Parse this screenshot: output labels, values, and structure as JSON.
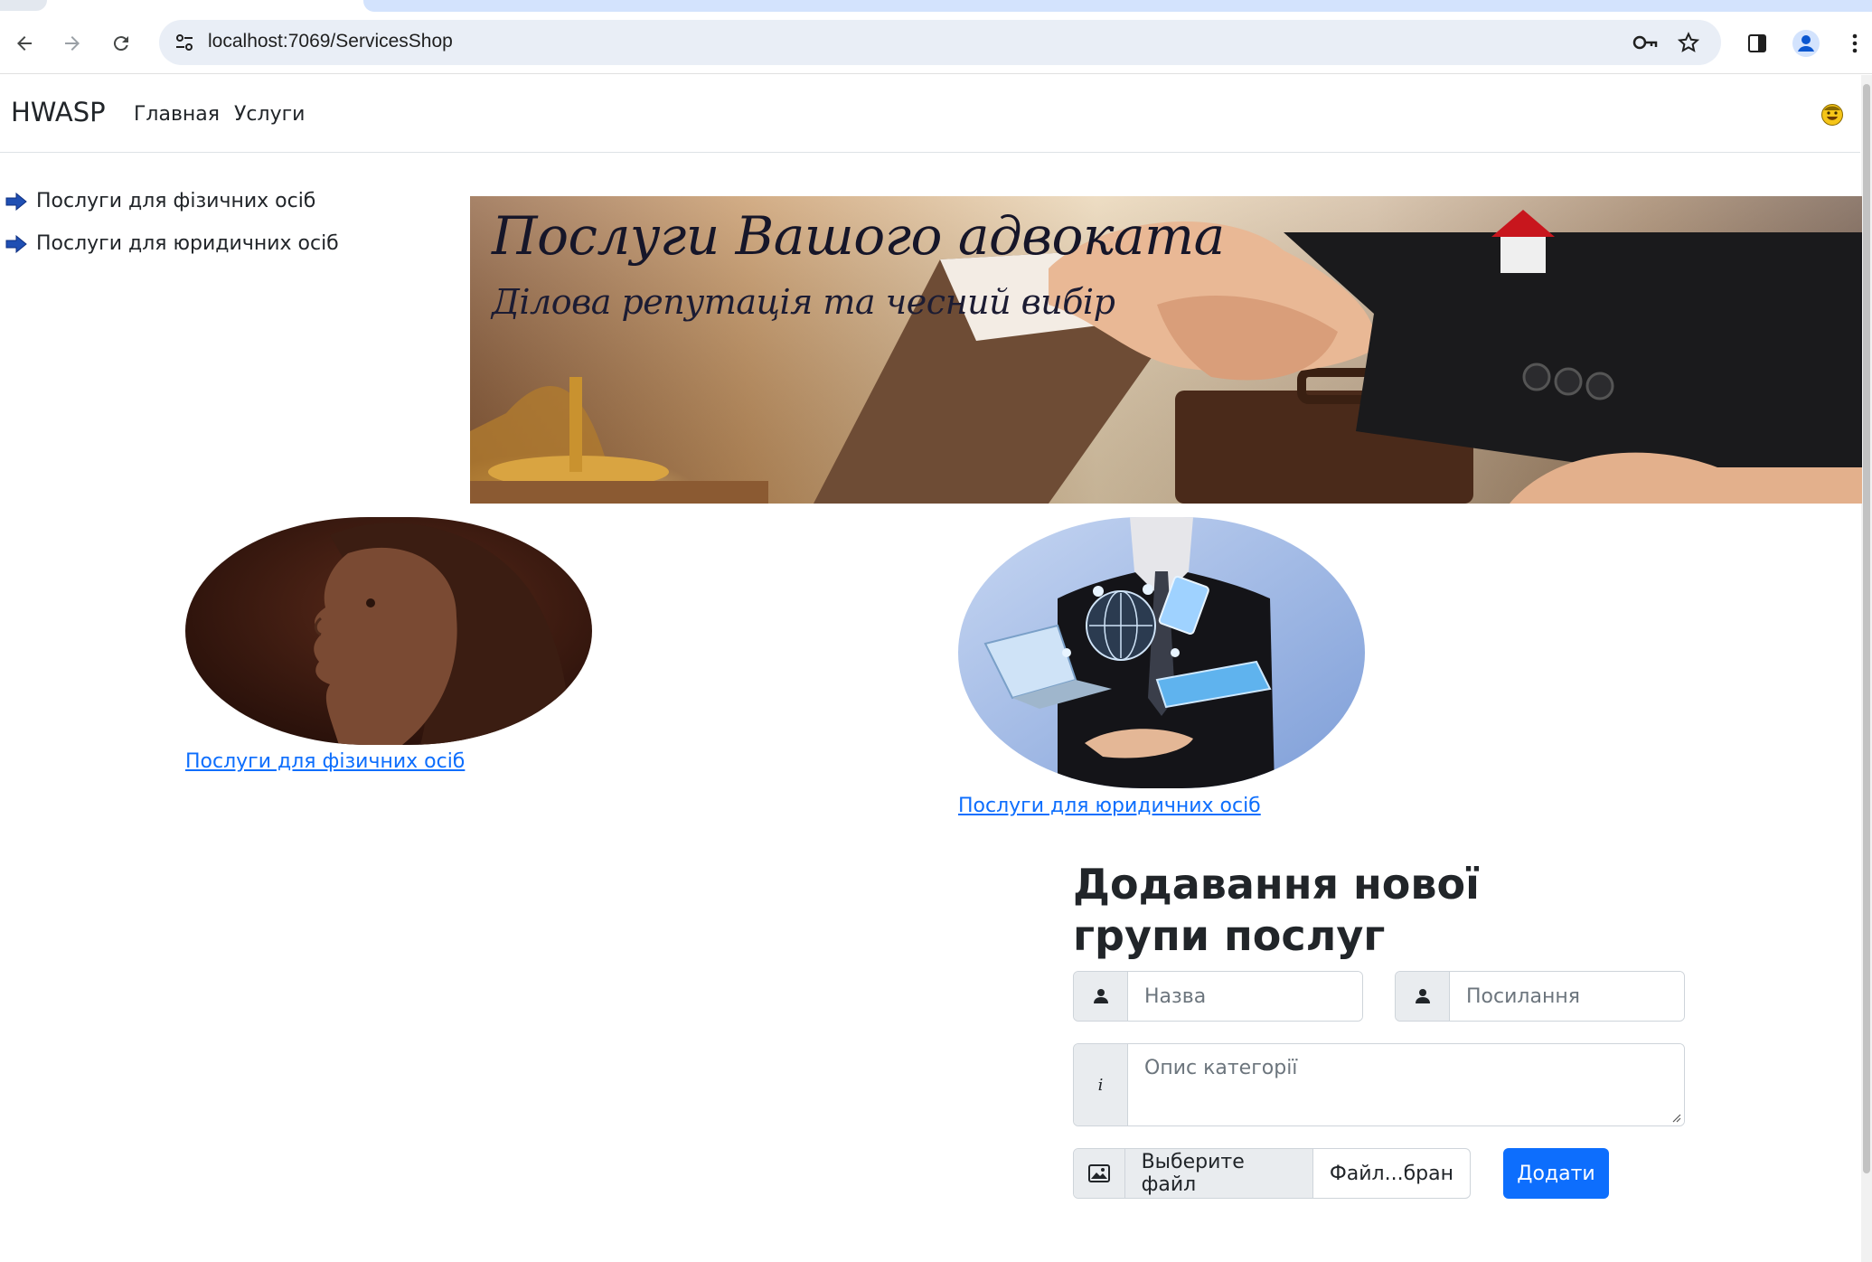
{
  "browser": {
    "url": "localhost:7069/ServicesShop"
  },
  "navbar": {
    "brand": "HWASP",
    "links": [
      "Главная",
      "Услуги"
    ]
  },
  "sidebar": {
    "items": [
      "Послуги для фізичних осіб",
      "Послуги для юридичних осіб"
    ]
  },
  "banner": {
    "title": "Послуги Вашого адвоката",
    "subtitle": "Ділова репутація та чесний вибір"
  },
  "categories": [
    {
      "link": "Послуги для фізичних осіб"
    },
    {
      "link": "Послуги для юридичних осіб"
    }
  ],
  "form": {
    "title": "Додавання нової групи послуг",
    "name_placeholder": "Назва",
    "link_placeholder": "Посилання",
    "description_placeholder": "Опис категорії",
    "info_addon": "i",
    "file_button": "Выберите файл",
    "file_name": "Файл...бран",
    "submit": "Додати"
  },
  "colors": {
    "primary": "#0d6efd",
    "omnibox": "#e9eef6",
    "tab_active": "#d3e3fd"
  },
  "icons": [
    "back-icon",
    "forward-icon",
    "reload-icon",
    "site-settings-icon",
    "key-icon",
    "star-icon",
    "side-panel-icon",
    "profile-icon",
    "menu-icon",
    "smiley-icon",
    "arrow-right-icon",
    "user-icon",
    "info-icon",
    "image-icon"
  ]
}
